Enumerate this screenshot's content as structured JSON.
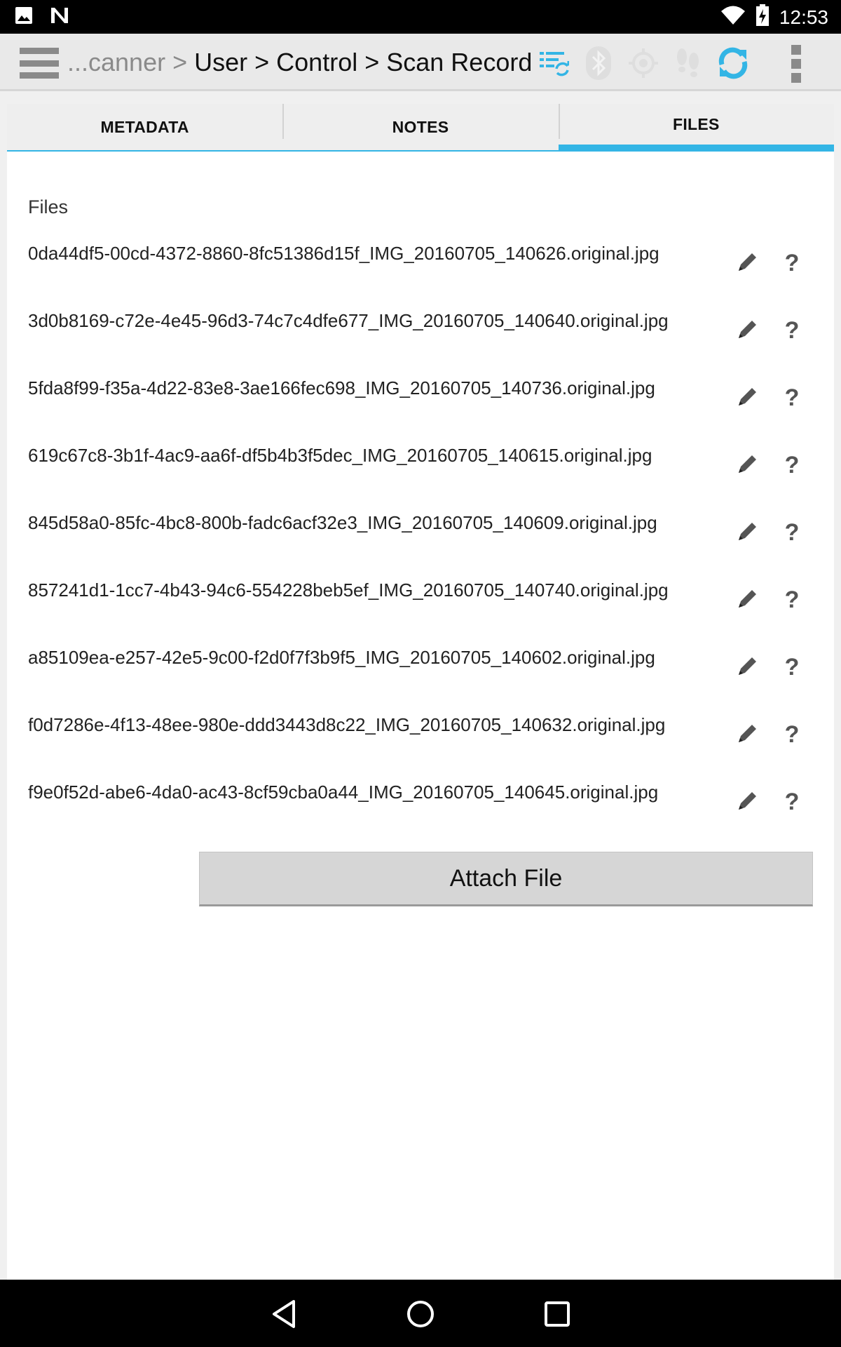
{
  "status_bar": {
    "time": "12:53",
    "icons": [
      "image-notification-icon",
      "n-notification-icon",
      "wifi-icon",
      "battery-charging-icon"
    ]
  },
  "action_bar": {
    "breadcrumb_prefix": "...canner >",
    "breadcrumb_rest": "User > Control > Scan Record",
    "icons": [
      "sync-list-icon",
      "bluetooth-icon",
      "gps-icon",
      "footsteps-icon",
      "refresh-icon",
      "overflow-menu-icon"
    ],
    "accent_color": "#33b5e5"
  },
  "tabs": [
    {
      "label": "METADATA",
      "active": false
    },
    {
      "label": "NOTES",
      "active": false
    },
    {
      "label": "FILES",
      "active": true
    }
  ],
  "files_section": {
    "heading": "Files",
    "files": [
      "0da44df5-00cd-4372-8860-8fc51386d15f_IMG_20160705_140626.original.jpg",
      "3d0b8169-c72e-4e45-96d3-74c7c4dfe677_IMG_20160705_140640.original.jpg",
      "5fda8f99-f35a-4d22-83e8-3ae166fec698_IMG_20160705_140736.original.jpg",
      "619c67c8-3b1f-4ac9-aa6f-df5b4b3f5dec_IMG_20160705_140615.original.jpg",
      "845d58a0-85fc-4bc8-800b-fadc6acf32e3_IMG_20160705_140609.original.jpg",
      "857241d1-1cc7-4b43-94c6-554228beb5ef_IMG_20160705_140740.original.jpg",
      "a85109ea-e257-42e5-9c00-f2d0f7f3b9f5_IMG_20160705_140602.original.jpg",
      "f0d7286e-4f13-48ee-980e-ddd3443d8c22_IMG_20160705_140632.original.jpg",
      "f9e0f52d-abe6-4da0-ac43-8cf59cba0a44_IMG_20160705_140645.original.jpg"
    ],
    "help_glyph": "?",
    "attach_label": "Attach File"
  },
  "nav_bar": {
    "icons": [
      "back-icon",
      "home-icon",
      "recents-icon"
    ]
  }
}
